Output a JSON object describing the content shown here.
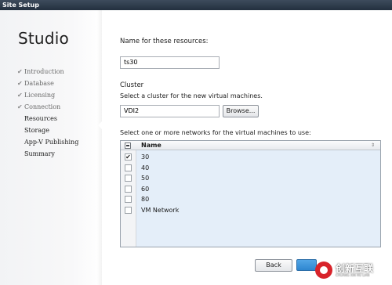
{
  "window": {
    "title": "Site Setup"
  },
  "sidebar": {
    "heading": "Studio",
    "steps": [
      {
        "label": "Introduction",
        "done": true
      },
      {
        "label": "Database",
        "done": true
      },
      {
        "label": "Licensing",
        "done": true
      },
      {
        "label": "Connection",
        "done": true
      },
      {
        "label": "Resources",
        "done": false,
        "current": true
      },
      {
        "label": "Storage",
        "done": false
      },
      {
        "label": "App-V Publishing",
        "done": false
      },
      {
        "label": "Summary",
        "done": false
      }
    ],
    "check_glyph": "✔"
  },
  "main": {
    "name_label": "Name for these resources:",
    "name_value": "ts30",
    "cluster_heading": "Cluster",
    "cluster_desc": "Select a cluster for the new virtual machines.",
    "cluster_value": "VDI2",
    "browse_label": "Browse...",
    "networks_label": "Select one or more networks for the virtual machines to use:",
    "networks": {
      "column_header": "Name",
      "sort_icon": "sort-icon",
      "rows": [
        {
          "name": "30",
          "checked": true
        },
        {
          "name": "40",
          "checked": false
        },
        {
          "name": "50",
          "checked": false
        },
        {
          "name": "60",
          "checked": false
        },
        {
          "name": "80",
          "checked": false
        },
        {
          "name": "VM Network",
          "checked": false
        }
      ]
    }
  },
  "footer": {
    "back_label": "Back"
  },
  "watermark": {
    "text": "创新互联",
    "subtext": "CHUANG XIN HU LIAN"
  }
}
